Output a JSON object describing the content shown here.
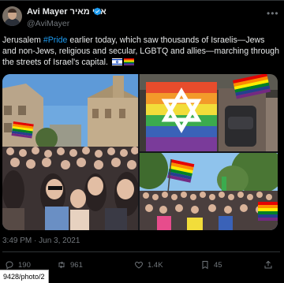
{
  "author": {
    "name": "Avi Mayer אבי מאיר",
    "handle": "@AviMayer",
    "verified": true
  },
  "tweet": {
    "text_before": "Jerusalem ",
    "hashtag": "#Pride",
    "text_after": " earlier today, which saw thousands of Israelis—Jews and non-Jews, religious and secular, LGBTQ and allies—marching through the streets of Israel's capital.",
    "timestamp": "3:49 PM · Jun 3, 2021"
  },
  "stats": {
    "replies": "190",
    "retweets": "961",
    "likes": "1.4K",
    "bookmarks": "45"
  },
  "photos": [
    {
      "description": "crowd-with-rainbow-flags-old-city"
    },
    {
      "description": "rainbow-flag-with-star-of-david"
    },
    {
      "description": "crowd-march-trees-rainbow-flags"
    }
  ],
  "status_url": "9428/photo/2",
  "colors": {
    "background": "#000000",
    "text": "#e7e9ea",
    "muted": "#71767b",
    "accent": "#1d9bf0"
  }
}
